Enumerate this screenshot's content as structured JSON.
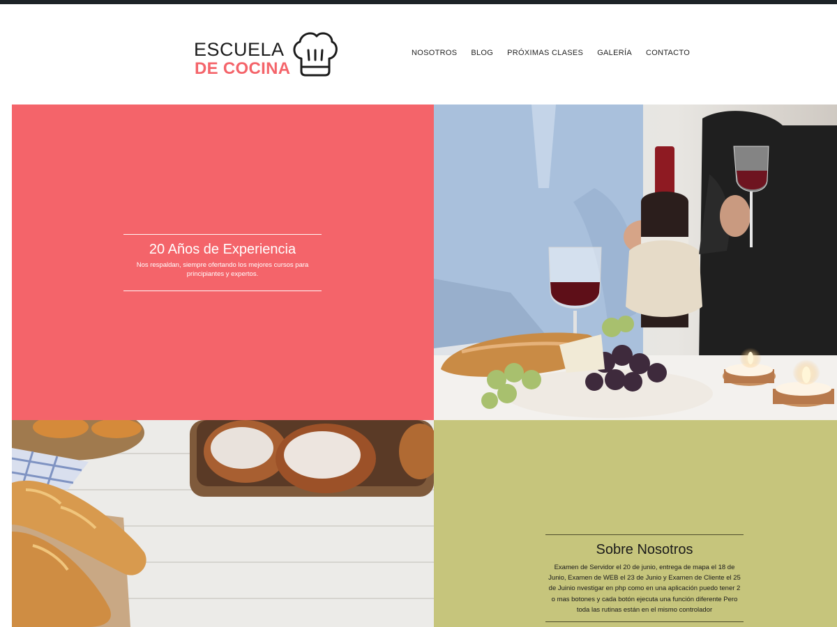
{
  "brand": {
    "line1": "ESCUELA",
    "line2": "DE COCINA",
    "accent_color": "#f4646a",
    "icon": "chef-hat-icon"
  },
  "nav": {
    "items": [
      "NOSOTROS",
      "BLOG",
      "PRÓXIMAS CLASES",
      "GALERÍA",
      "CONTACTO"
    ]
  },
  "experience": {
    "title": "20 Años de Experiencia",
    "text": "Nos respaldan, siempre ofertando los mejores cursos para principiantes y expertos.",
    "bg_color": "#f4646a"
  },
  "about": {
    "title": "Sobre Nosotros",
    "text": "Examen de Servidor el 20 de junio, entrega de mapa el 18 de Junio, Examen de WEB el 23 de Junio y Examen de Cliente el 25 de Juinio nvestigar en php como en una aplicación puedo tener 2 o mas botones y cada botón ejecuta una función diferente Pero toda las rutinas están en el mismo controlador",
    "bg_color": "#c6c57c"
  },
  "images": {
    "dinner": "wine-dinner-photo",
    "bread": "bread-on-table-photo"
  }
}
